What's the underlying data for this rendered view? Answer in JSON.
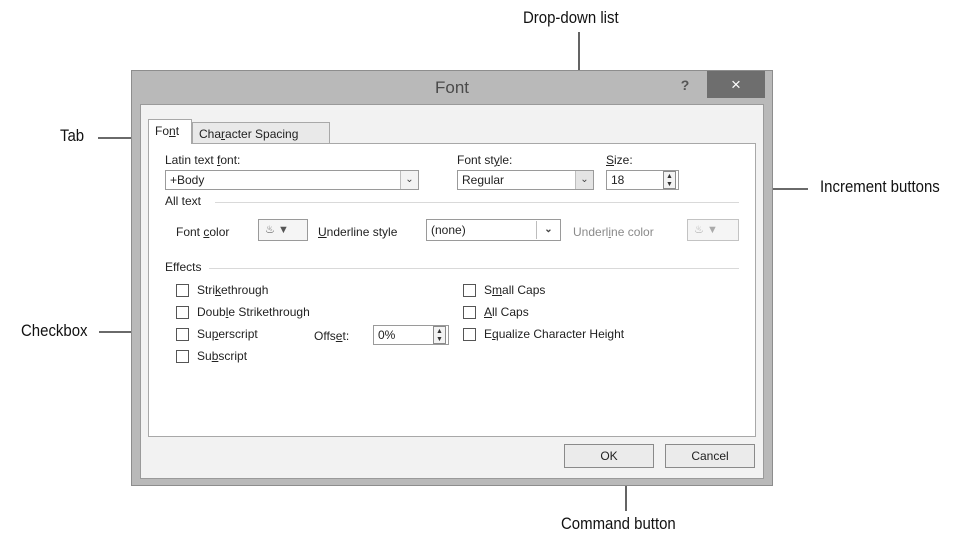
{
  "dialog": {
    "title": "Font",
    "help_label": "?",
    "close_label": "×"
  },
  "tabs": {
    "font": {
      "pre": "Fo",
      "key": "n",
      "post": "t"
    },
    "spacing": {
      "pre": "Cha",
      "key": "r",
      "post": "acter Spacing"
    }
  },
  "font_tab": {
    "latin_font_label": {
      "pre": "Latin text ",
      "key": "f",
      "post": "ont:"
    },
    "latin_font_value": "+Body",
    "font_style_label": {
      "pre": "Font st",
      "key": "y",
      "post": "le:"
    },
    "font_style_value": "Regular",
    "size_label": {
      "pre": "",
      "key": "S",
      "post": "ize:"
    },
    "size_value": "18",
    "all_text_label": "All text",
    "font_color_label": {
      "pre": "Font ",
      "key": "c",
      "post": "olor"
    },
    "underline_style_label": {
      "pre": "",
      "key": "U",
      "post": "nderline style"
    },
    "underline_style_value": "(none)",
    "underline_color_label": {
      "pre": "Underl",
      "key": "i",
      "post": "ne color"
    },
    "effects_label": "Effects",
    "effects": {
      "strikethrough": {
        "pre": "Stri",
        "key": "k",
        "post": "ethrough"
      },
      "double_strikethrough": {
        "pre": "Doub",
        "key": "l",
        "post": "e Strikethrough"
      },
      "superscript": {
        "pre": "Su",
        "key": "p",
        "post": "erscript"
      },
      "subscript": {
        "pre": "Su",
        "key": "b",
        "post": "script"
      },
      "small_caps": {
        "pre": "S",
        "key": "m",
        "post": "all Caps"
      },
      "all_caps": {
        "pre": "",
        "key": "A",
        "post": "ll Caps"
      },
      "equalize": {
        "pre": "E",
        "key": "q",
        "post": "ualize Character Height"
      }
    },
    "offset_label": {
      "pre": "Offs",
      "key": "e",
      "post": "t:"
    },
    "offset_value": "0%"
  },
  "buttons": {
    "ok": "OK",
    "cancel": "Cancel"
  },
  "callouts": {
    "tab": "Tab",
    "checkbox": "Checkbox",
    "dropdown": "Drop-down list",
    "increment": "Increment buttons",
    "command": "Command button"
  },
  "icons": {
    "paint_bucket": "paint-bucket-icon",
    "dropdown_arrow": "chevron-down-icon"
  }
}
